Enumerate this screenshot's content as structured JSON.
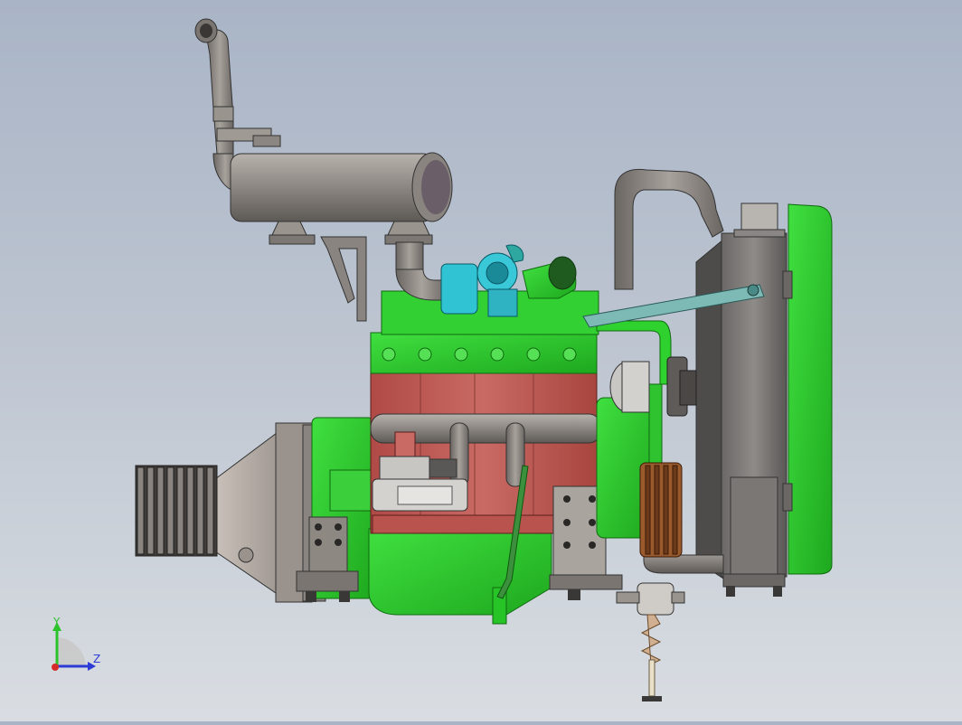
{
  "viewport": {
    "background_top": "#a9b4c6",
    "background_bottom": "#d9dde2"
  },
  "model": {
    "block_color": "#c25b57",
    "engine_green": "#2fd12f",
    "steel_color": "#8c8682",
    "turbo_color": "#2fc3d3",
    "pulley_color": "#9a5a2c"
  },
  "triad": {
    "y_label": "Y",
    "z_label": "Z",
    "y_color": "#2cc22c",
    "z_color": "#2b3bd6",
    "x_color": "#d62b2b"
  }
}
